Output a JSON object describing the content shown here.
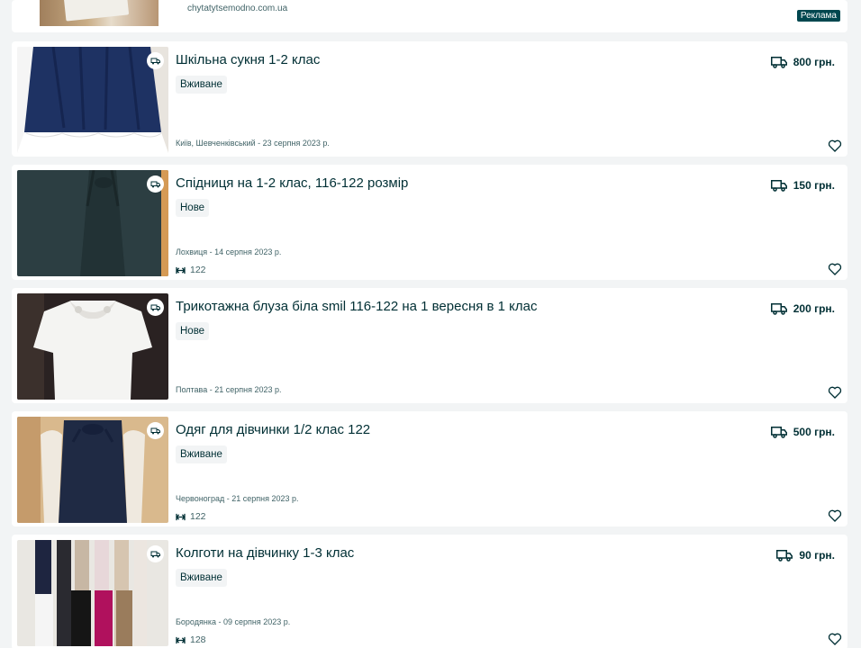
{
  "ad": {
    "url": "chytatytsemodno.com.ua",
    "badge": "Реклама"
  },
  "listings": [
    {
      "title": "Шкільна сукня 1-2 клас",
      "condition": "Вживане",
      "location_date": "Київ, Шевченківський - 23 серпня 2023 р.",
      "size": "",
      "price": "800 грн.",
      "image_icon": "dress-photo"
    },
    {
      "title": "Спідниця на 1-2 клас, 116-122 розмір",
      "condition": "Нове",
      "location_date": "Лохвиця - 14 серпня 2023 р.",
      "size": "122",
      "price": "150 грн.",
      "image_icon": "skirt-photo"
    },
    {
      "title": "Трикотажна блуза біла smil 116-122 на 1 вересня в 1 клас",
      "condition": "Нове",
      "location_date": "Полтава - 21 серпня 2023 р.",
      "size": "",
      "price": "200 грн.",
      "image_icon": "blouse-photo"
    },
    {
      "title": "Одяг для дівчинки 1/2 клас 122",
      "condition": "Вживане",
      "location_date": "Червоноград - 21 серпня 2023 р.",
      "size": "122",
      "price": "500 грн.",
      "image_icon": "girl-clothes-photo"
    },
    {
      "title": "Колготи на дівчинку 1-3 клас",
      "condition": "Вживане",
      "location_date": "Бородянка - 09 серпня 2023 р.",
      "size": "128",
      "price": "90 грн.",
      "image_icon": "tights-photo"
    }
  ],
  "icons": {
    "delivery": "truck-icon",
    "favorite": "heart-icon",
    "size": "size-arrows-icon"
  },
  "colors": {
    "text": "#002f34",
    "muted": "#406367",
    "badge_bg": "#00474f",
    "page_bg": "#f2f4f5"
  }
}
